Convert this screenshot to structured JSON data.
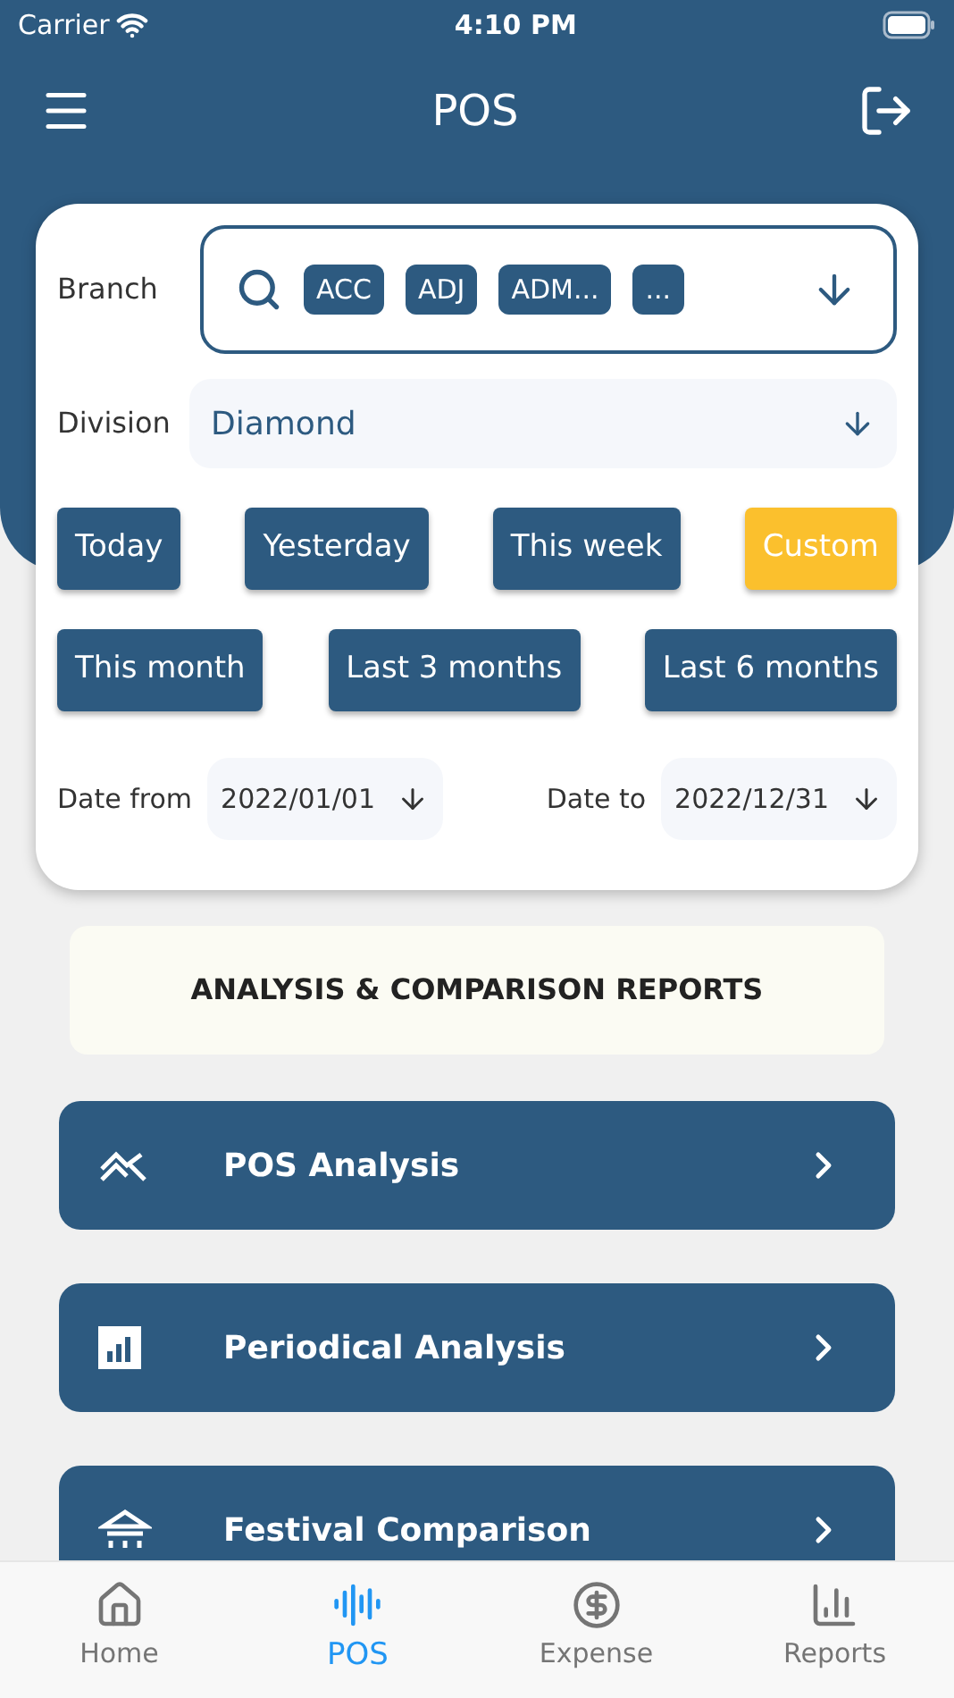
{
  "status_bar": {
    "carrier": "Carrier",
    "time": "4:10 PM"
  },
  "header": {
    "title": "POS"
  },
  "filters": {
    "branch_label": "Branch",
    "branch_chips": [
      "ACC",
      "ADJ",
      "ADM...",
      "..."
    ],
    "division_label": "Division",
    "division_value": "Diamond",
    "range_rows": [
      {
        "options": [
          {
            "label": "Today",
            "selected": false
          },
          {
            "label": "Yesterday",
            "selected": false
          },
          {
            "label": "This week",
            "selected": false
          },
          {
            "label": "Custom",
            "selected": true
          }
        ]
      },
      {
        "options": [
          {
            "label": "This month",
            "selected": false
          },
          {
            "label": "Last 3 months",
            "selected": false
          },
          {
            "label": "Last 6 months",
            "selected": false
          }
        ]
      }
    ],
    "date_from_label": "Date from",
    "date_from": "2022/01/01",
    "date_to_label": "Date to",
    "date_to": "2022/12/31"
  },
  "section_title": "ANALYSIS & COMPARISON REPORTS",
  "reports": [
    {
      "kind": "trend",
      "label": "POS Analysis"
    },
    {
      "kind": "chart",
      "label": "Periodical Analysis"
    },
    {
      "kind": "festival",
      "label": "Festival Comparison"
    }
  ],
  "tab_bar": [
    {
      "kind": "home",
      "label": "Home",
      "selected": false
    },
    {
      "kind": "pos",
      "label": "POS",
      "selected": true
    },
    {
      "kind": "expense",
      "label": "Expense",
      "selected": false
    },
    {
      "kind": "reports",
      "label": "Reports",
      "selected": false
    }
  ]
}
